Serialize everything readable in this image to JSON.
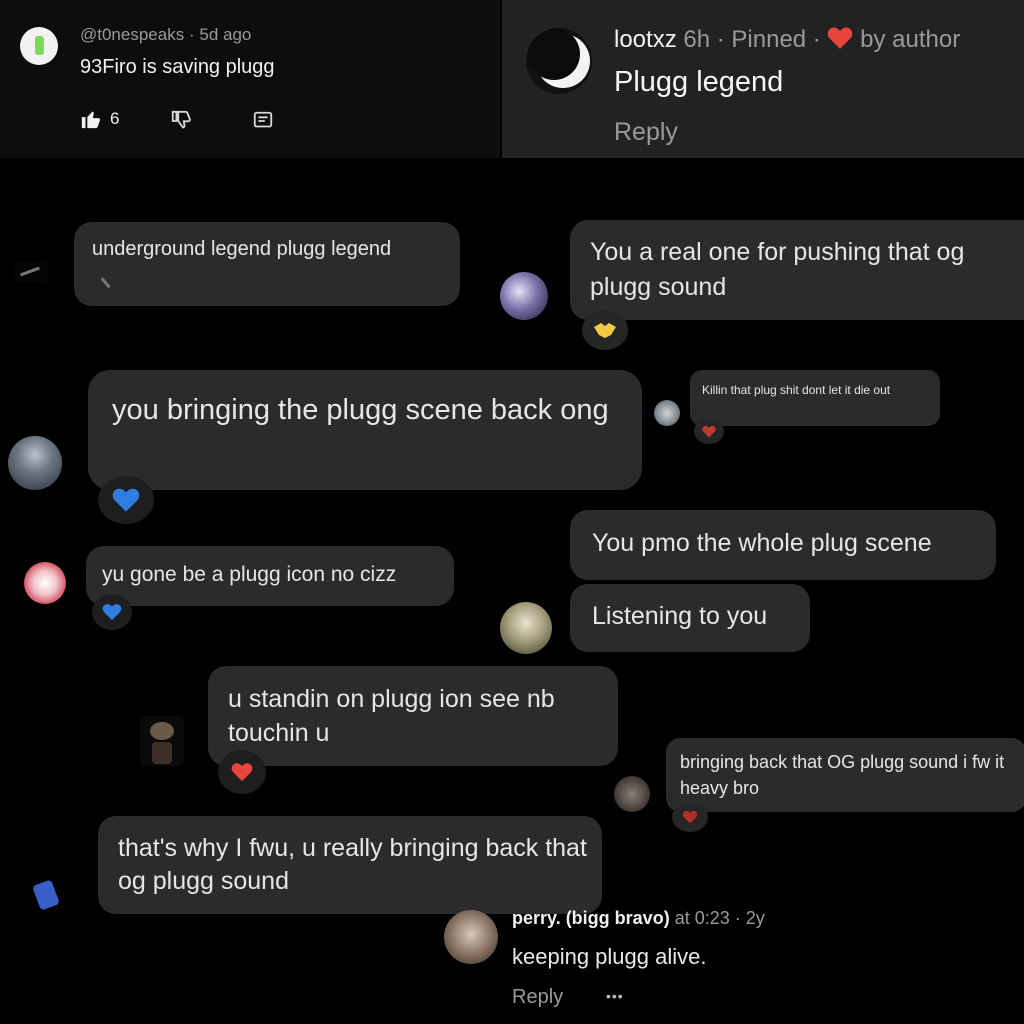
{
  "yt_comment": {
    "handle": "@t0nespeaks",
    "separator": "·",
    "time": "5d ago",
    "text": "93Firo is saving plugg",
    "likes": "6"
  },
  "pinned_comment": {
    "user": "lootxz",
    "time": "6h",
    "pinned": "· Pinned ·",
    "by_author": "by author",
    "text": "Plugg legend",
    "reply": "Reply"
  },
  "bubbles": {
    "b1": "underground legend plugg legend",
    "b2": "You a real one for pushing that og plugg sound",
    "b3": "you bringing the plugg scene back ong",
    "b4": "Killin that plug shit dont let it die out",
    "b5": "You pmo the whole plug scene",
    "b6": "yu gone be a plugg icon no cizz",
    "b7": "Listening to you",
    "b8": "u standin on plugg ion see nb touchin u",
    "b9": "bringing back that OG plugg sound i fw it heavy bro",
    "b10": "that's why I fwu, u really bringing back that og plugg sound"
  },
  "bottom_comment": {
    "user": "perry. (bigg bravo)",
    "meta": "at 0:23 · 2y",
    "text": "keeping plugg alive.",
    "reply": "Reply",
    "more": "•••"
  },
  "reactions": {
    "b2": "handshake-emoji",
    "b3": "blue-heart-emoji",
    "b4": "red-heart-emoji",
    "b6": "blue-heart-emoji",
    "b8": "red-heart-emoji",
    "b9": "red-heart-emoji"
  },
  "colors": {
    "bubble": "#2b2b2d",
    "heart_red": "#e8453c",
    "heart_blue": "#2f7de0",
    "handshake": "#f2c744"
  }
}
